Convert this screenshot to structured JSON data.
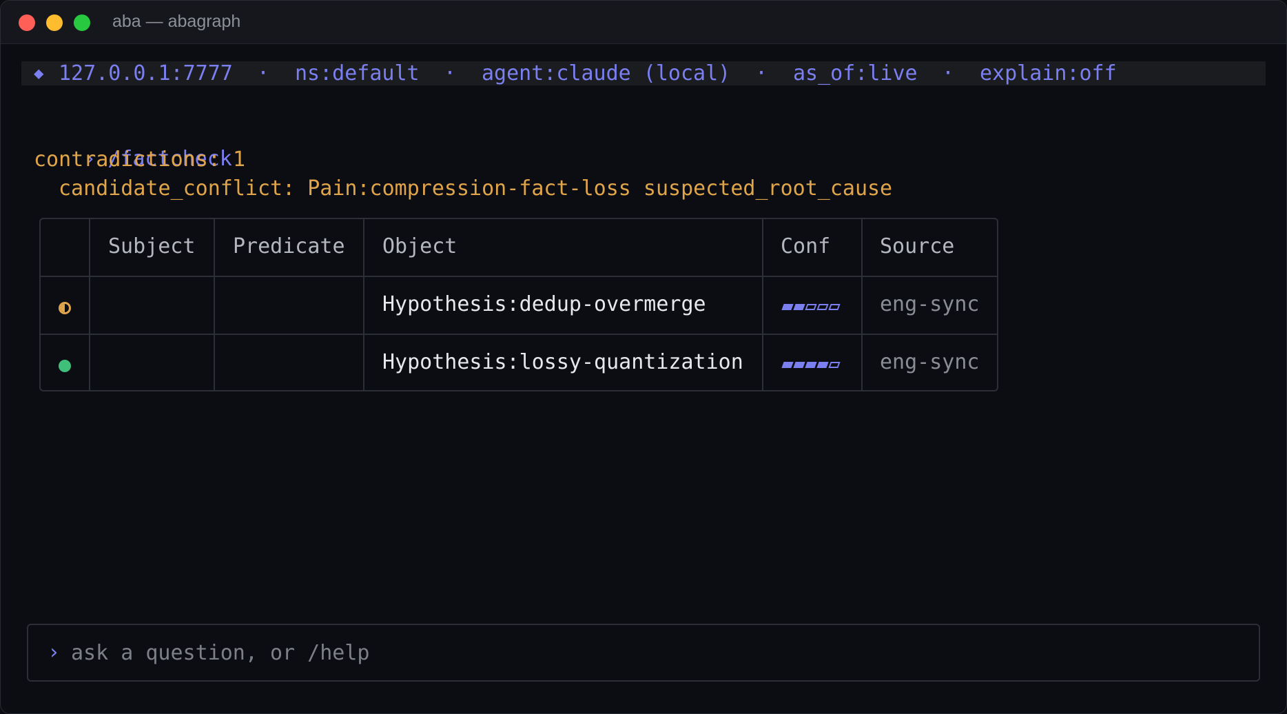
{
  "window": {
    "title": "aba — abagraph",
    "traffic_colors": {
      "close": "#ff5f57",
      "minimize": "#febc2e",
      "maximize": "#28c840"
    }
  },
  "status": {
    "diamond_icon": "diamond-icon",
    "host": "127.0.0.1:7777",
    "ns": "ns:default",
    "agent": "agent:claude (local)",
    "as_of": "as_of:live",
    "explain": "explain:off",
    "separator": "·",
    "color": "#7b7ff0"
  },
  "session": {
    "prompt_symbol": "›",
    "command": "/factcheck",
    "contradictions": "contradictions: 1",
    "conflict": "candidate_conflict: Pain:compression-fact-loss suspected_root_cause"
  },
  "table": {
    "columns": [
      "",
      "Subject",
      "Predicate",
      "Object",
      "Conf",
      "Source"
    ],
    "rows": [
      {
        "status_icon": "half-circle-icon",
        "status_color": "#e0a54a",
        "subject": "",
        "predicate": "",
        "object": "Hypothesis:dedup-overmerge",
        "conf_level": 2,
        "conf_max": 5,
        "source": "eng-sync"
      },
      {
        "status_icon": "filled-circle-icon",
        "status_color": "#3fbf7a",
        "subject": "",
        "predicate": "",
        "object": "Hypothesis:lossy-quantization",
        "conf_level": 4,
        "conf_max": 5,
        "source": "eng-sync"
      }
    ]
  },
  "input": {
    "prompt_symbol": "›",
    "placeholder": "ask a question, or /help"
  },
  "colors": {
    "accent": "#7b7ff0",
    "warning": "#e0a54a",
    "text": "#e6e8ec",
    "muted": "#8a8d94",
    "header": "#b4b7bd"
  }
}
